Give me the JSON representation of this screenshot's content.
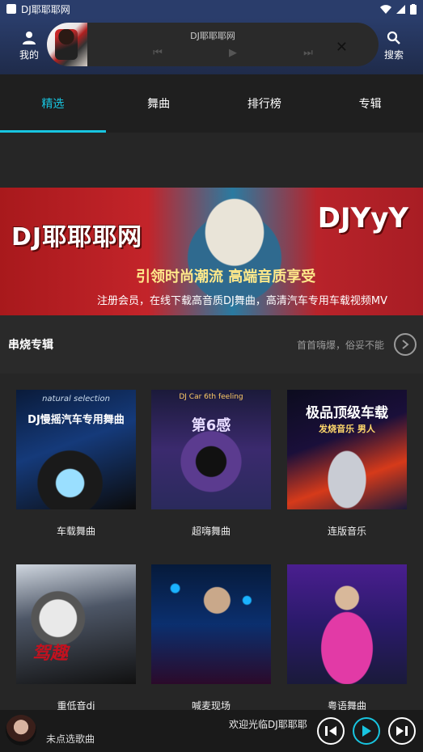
{
  "status_bar": {
    "app_name": "DJ耶耶耶网"
  },
  "header": {
    "me_label": "我的",
    "search_label": "搜索",
    "mini_player": {
      "title": "DJ耶耶耶网",
      "prev": "⏮",
      "play": "▶",
      "next": "⏭",
      "close": "✕"
    }
  },
  "tabs": [
    {
      "label": "精选",
      "active": true
    },
    {
      "label": "舞曲",
      "active": false
    },
    {
      "label": "排行榜",
      "active": false
    },
    {
      "label": "专辑",
      "active": false
    }
  ],
  "banner": {
    "logo_left": "DJ耶耶耶网",
    "logo_right": "DJYyY",
    "slogan": "引领时尚潮流 高端音质享受",
    "subline": "注册会员，在线下载高音质DJ舞曲，高清汽车专用车载视频MV"
  },
  "section": {
    "title": "串烧专辑",
    "subtitle": "首首嗨爆，俗妥不能",
    "more_icon": "chevron-right-icon"
  },
  "albums": [
    {
      "label": "车载舞曲",
      "cover_text": "DJ慢摇汽车专用舞曲",
      "cover_top": "natural selection"
    },
    {
      "label": "超嗨舞曲",
      "cover_text": "第6感",
      "cover_top": "DJ Car 6th feeling"
    },
    {
      "label": "连版音乐",
      "cover_text": "极品顶级车载",
      "cover_sub": "发烧音乐 男人"
    },
    {
      "label": "重低音dj",
      "cover_text": "驾趣"
    },
    {
      "label": "喊麦现场"
    },
    {
      "label": "粤语舞曲"
    }
  ],
  "bottom_player": {
    "status": "未点选歌曲",
    "welcome": "欢迎光临DJ耶耶耶"
  },
  "colors": {
    "accent": "#18c5e0",
    "header_bg": "#2a3d6b",
    "page_bg": "#262626"
  }
}
